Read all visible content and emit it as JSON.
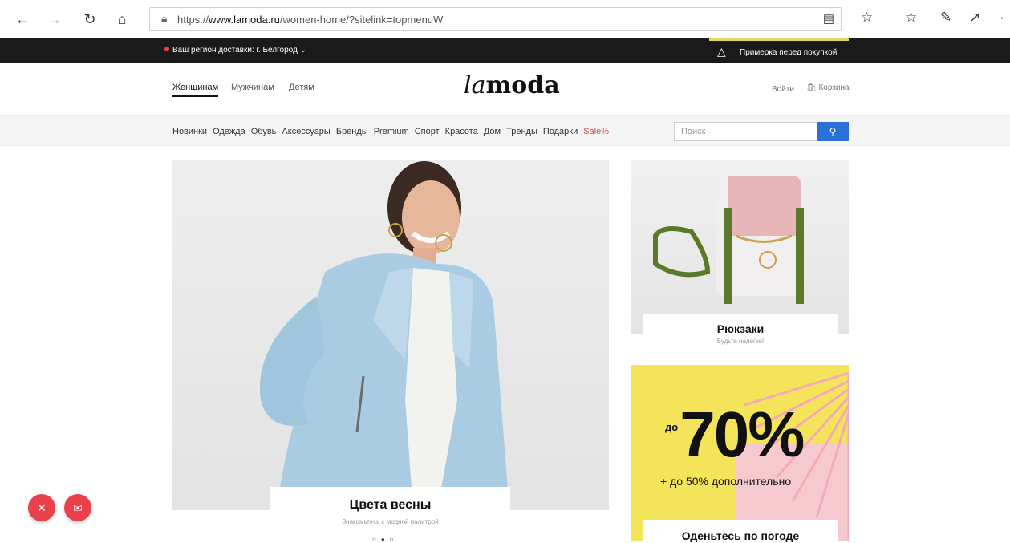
{
  "browser": {
    "url_prefix": "https://",
    "url_host": "www.lamoda.ru",
    "url_path": "/women-home/?sitelink=topmenuW"
  },
  "topbar": {
    "region_label": "Ваш регион доставки:",
    "region_value": "г. Белгород",
    "fitting_label": "Примерка перед покупкой"
  },
  "header": {
    "gender_tabs": [
      "Женщинам",
      "Мужчинам",
      "Детям"
    ],
    "logo_italic": "la",
    "logo_bold": "moda",
    "login": "Войти",
    "cart": "Корзина"
  },
  "categories": [
    "Новинки",
    "Одежда",
    "Обувь",
    "Аксессуары",
    "Бренды",
    "Premium",
    "Спорт",
    "Красота",
    "Дом",
    "Тренды",
    "Подарки",
    "Sale%"
  ],
  "search": {
    "placeholder": "Поиск"
  },
  "hero": {
    "title": "Цвета весны",
    "subtitle": "Знакомьтесь с модной палитрой"
  },
  "promo1": {
    "title": "Рюкзаки",
    "subtitle": "Будьте налегке!"
  },
  "promo2": {
    "prefix": "до",
    "value": "70%",
    "extra": "+ до 50% дополнительно",
    "title": "Оденьтесь по погоде"
  },
  "colors": {
    "accent": "#e9414c",
    "search_button": "#2c6fd6",
    "promo_yellow": "#f4e45a",
    "sale": "#e04545"
  }
}
